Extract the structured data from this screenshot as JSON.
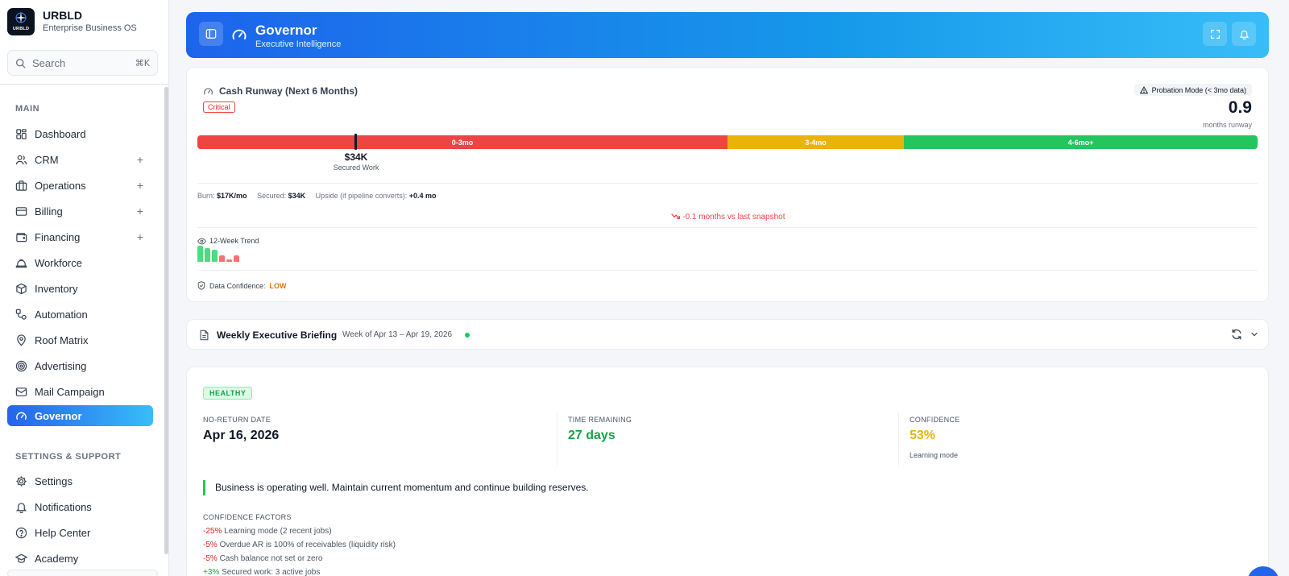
{
  "brand": {
    "name": "URBLD",
    "subtitle": "Enterprise Business OS",
    "logo_text": "URBLD"
  },
  "search": {
    "placeholder": "Search",
    "shortcut": "⌘K"
  },
  "sidebar": {
    "main_label": "MAIN",
    "items": [
      {
        "label": "Dashboard",
        "icon": "grid-icon",
        "expandable": false
      },
      {
        "label": "CRM",
        "icon": "users-icon",
        "expandable": true
      },
      {
        "label": "Operations",
        "icon": "briefcase-icon",
        "expandable": true
      },
      {
        "label": "Billing",
        "icon": "credit-card-icon",
        "expandable": true
      },
      {
        "label": "Financing",
        "icon": "wallet-icon",
        "expandable": true
      },
      {
        "label": "Workforce",
        "icon": "hard-hat-icon",
        "expandable": false
      },
      {
        "label": "Inventory",
        "icon": "package-icon",
        "expandable": false
      },
      {
        "label": "Automation",
        "icon": "workflow-icon",
        "expandable": false
      },
      {
        "label": "Roof Matrix",
        "icon": "map-pin-icon",
        "expandable": false
      },
      {
        "label": "Advertising",
        "icon": "target-icon",
        "expandable": false
      },
      {
        "label": "Mail Campaign",
        "icon": "mail-icon",
        "expandable": false
      },
      {
        "label": "Governor",
        "icon": "gauge-icon",
        "expandable": false,
        "active": true
      }
    ],
    "support_label": "SETTINGS & SUPPORT",
    "support_items": [
      {
        "label": "Settings",
        "icon": "gear-icon"
      },
      {
        "label": "Notifications",
        "icon": "bell-icon"
      },
      {
        "label": "Help Center",
        "icon": "help-circle-icon"
      },
      {
        "label": "Academy",
        "icon": "graduation-cap-icon"
      }
    ],
    "expand_symbol": "+"
  },
  "header": {
    "title": "Governor",
    "subtitle": "Executive Intelligence"
  },
  "runway": {
    "title": "Cash Runway (Next 6 Months)",
    "status": "Critical",
    "probation": "Probation Mode (< 3mo data)",
    "months_value": "0.9",
    "months_label": "months runway",
    "segments": [
      {
        "label": "0-3mo",
        "color": "#ef4444"
      },
      {
        "label": "3-4mo",
        "color": "#eab308"
      },
      {
        "label": "4-6mo+",
        "color": "#22c55e"
      }
    ],
    "marker_value": "$34K",
    "marker_label": "Secured Work",
    "burn_label": "Burn:",
    "burn_value": "$17K/mo",
    "secured_label": "Secured:",
    "secured_value": "$34K",
    "upside_label": "Upside (if pipeline converts):",
    "upside_value": "+0.4 mo",
    "delta": "-0.1 months vs last snapshot",
    "trend_title": "12-Week Trend",
    "trend_bars": [
      {
        "level": 1.0,
        "color": "#4ade80"
      },
      {
        "level": 0.85,
        "color": "#4ade80"
      },
      {
        "level": 0.75,
        "color": "#4ade80"
      },
      {
        "level": 0.4,
        "color": "#f87171"
      },
      {
        "level": 0.15,
        "color": "#f87171"
      },
      {
        "level": 0.4,
        "color": "#f87171"
      }
    ],
    "confidence_label": "Data Confidence:",
    "confidence_value": "LOW"
  },
  "briefing": {
    "title": "Weekly Executive Briefing",
    "week": "Week of Apr 13 – Apr 19, 2026"
  },
  "health": {
    "status": "HEALTHY",
    "no_return_label": "NO-RETURN DATE",
    "no_return_value": "Apr 16, 2026",
    "time_label": "TIME REMAINING",
    "time_value": "27 days",
    "confidence_label": "CONFIDENCE",
    "confidence_value": "53%",
    "confidence_sub": "Learning mode",
    "message": "Business is operating well. Maintain current momentum and continue building reserves.",
    "factors_title": "CONFIDENCE FACTORS",
    "factors": [
      {
        "weight": "-25%",
        "text": "Learning mode (2 recent jobs)",
        "color": "#dc2626"
      },
      {
        "weight": "-5%",
        "text": "Overdue AR is 100% of receivables (liquidity risk)",
        "color": "#dc2626"
      },
      {
        "weight": "-5%",
        "text": "Cash balance not set or zero",
        "color": "#dc2626"
      },
      {
        "weight": "+3%",
        "text": "Secured work: 3 active jobs",
        "color": "#16a34a"
      }
    ]
  },
  "colors": {
    "accent": "#2563eb",
    "accent_light": "#38bdf8",
    "critical": "#ef4444",
    "warning": "#eab308",
    "success": "#22c55e",
    "amber": "#d97706"
  }
}
